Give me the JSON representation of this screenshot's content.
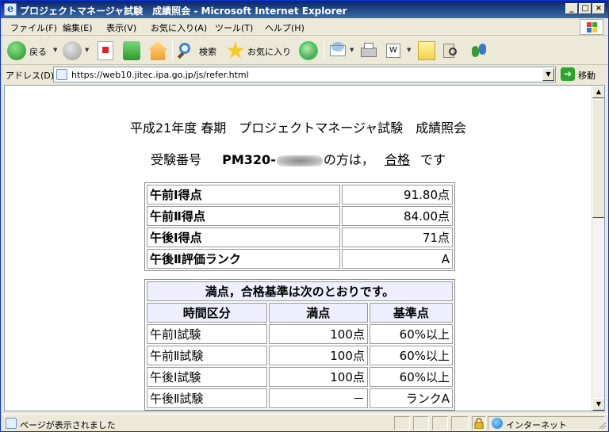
{
  "window": {
    "title": "プロジェクトマネージャ試験　成績照会 - Microsoft Internet Explorer",
    "buttons": {
      "minimize": "_",
      "maximize": "□",
      "close": "×"
    }
  },
  "menu": [
    "ファイル(F)",
    "編集(E)",
    "表示(V)",
    "お気に入り(A)",
    "ツール(T)",
    "ヘルプ(H)"
  ],
  "toolbar": {
    "back": "戻る",
    "search": "検索",
    "favorites": "お気に入り"
  },
  "address": {
    "label": "アドレス(D)",
    "url": "https://web10.jitec.ipa.go.jp/js/refer.html",
    "go": "移動"
  },
  "page": {
    "heading": "平成21年度 春期　プロジェクトマネージャ試験　成績照会",
    "result_prefix": "受験番号",
    "exam_number": "PM320-",
    "result_middle": "の方は，",
    "result_status": "合格",
    "result_suffix": "です",
    "scores": [
      {
        "label": "午前Ⅰ得点",
        "value": "91.80点"
      },
      {
        "label": "午前Ⅱ得点",
        "value": "84.00点"
      },
      {
        "label": "午後Ⅰ得点",
        "value": "71点"
      },
      {
        "label": "午後Ⅱ評価ランク",
        "value": "A"
      }
    ],
    "standards_caption": "満点，合格基準は次のとおりです。",
    "standards_headers": [
      "時間区分",
      "満点",
      "基準点"
    ],
    "standards": [
      {
        "period": "午前Ⅰ試験",
        "full": "100点",
        "pass": "60%以上"
      },
      {
        "period": "午前Ⅱ試験",
        "full": "100点",
        "pass": "60%以上"
      },
      {
        "period": "午後Ⅰ試験",
        "full": "100点",
        "pass": "60%以上"
      },
      {
        "period": "午後Ⅱ試験",
        "full": "－",
        "pass": "ランクA"
      }
    ]
  },
  "status": {
    "text": "ページが表示されました",
    "zone": "インターネット"
  },
  "colors": {
    "titlebar": "#0a246a",
    "table_header_bg": "#eeeeff",
    "go_button": "#2aa52a"
  }
}
